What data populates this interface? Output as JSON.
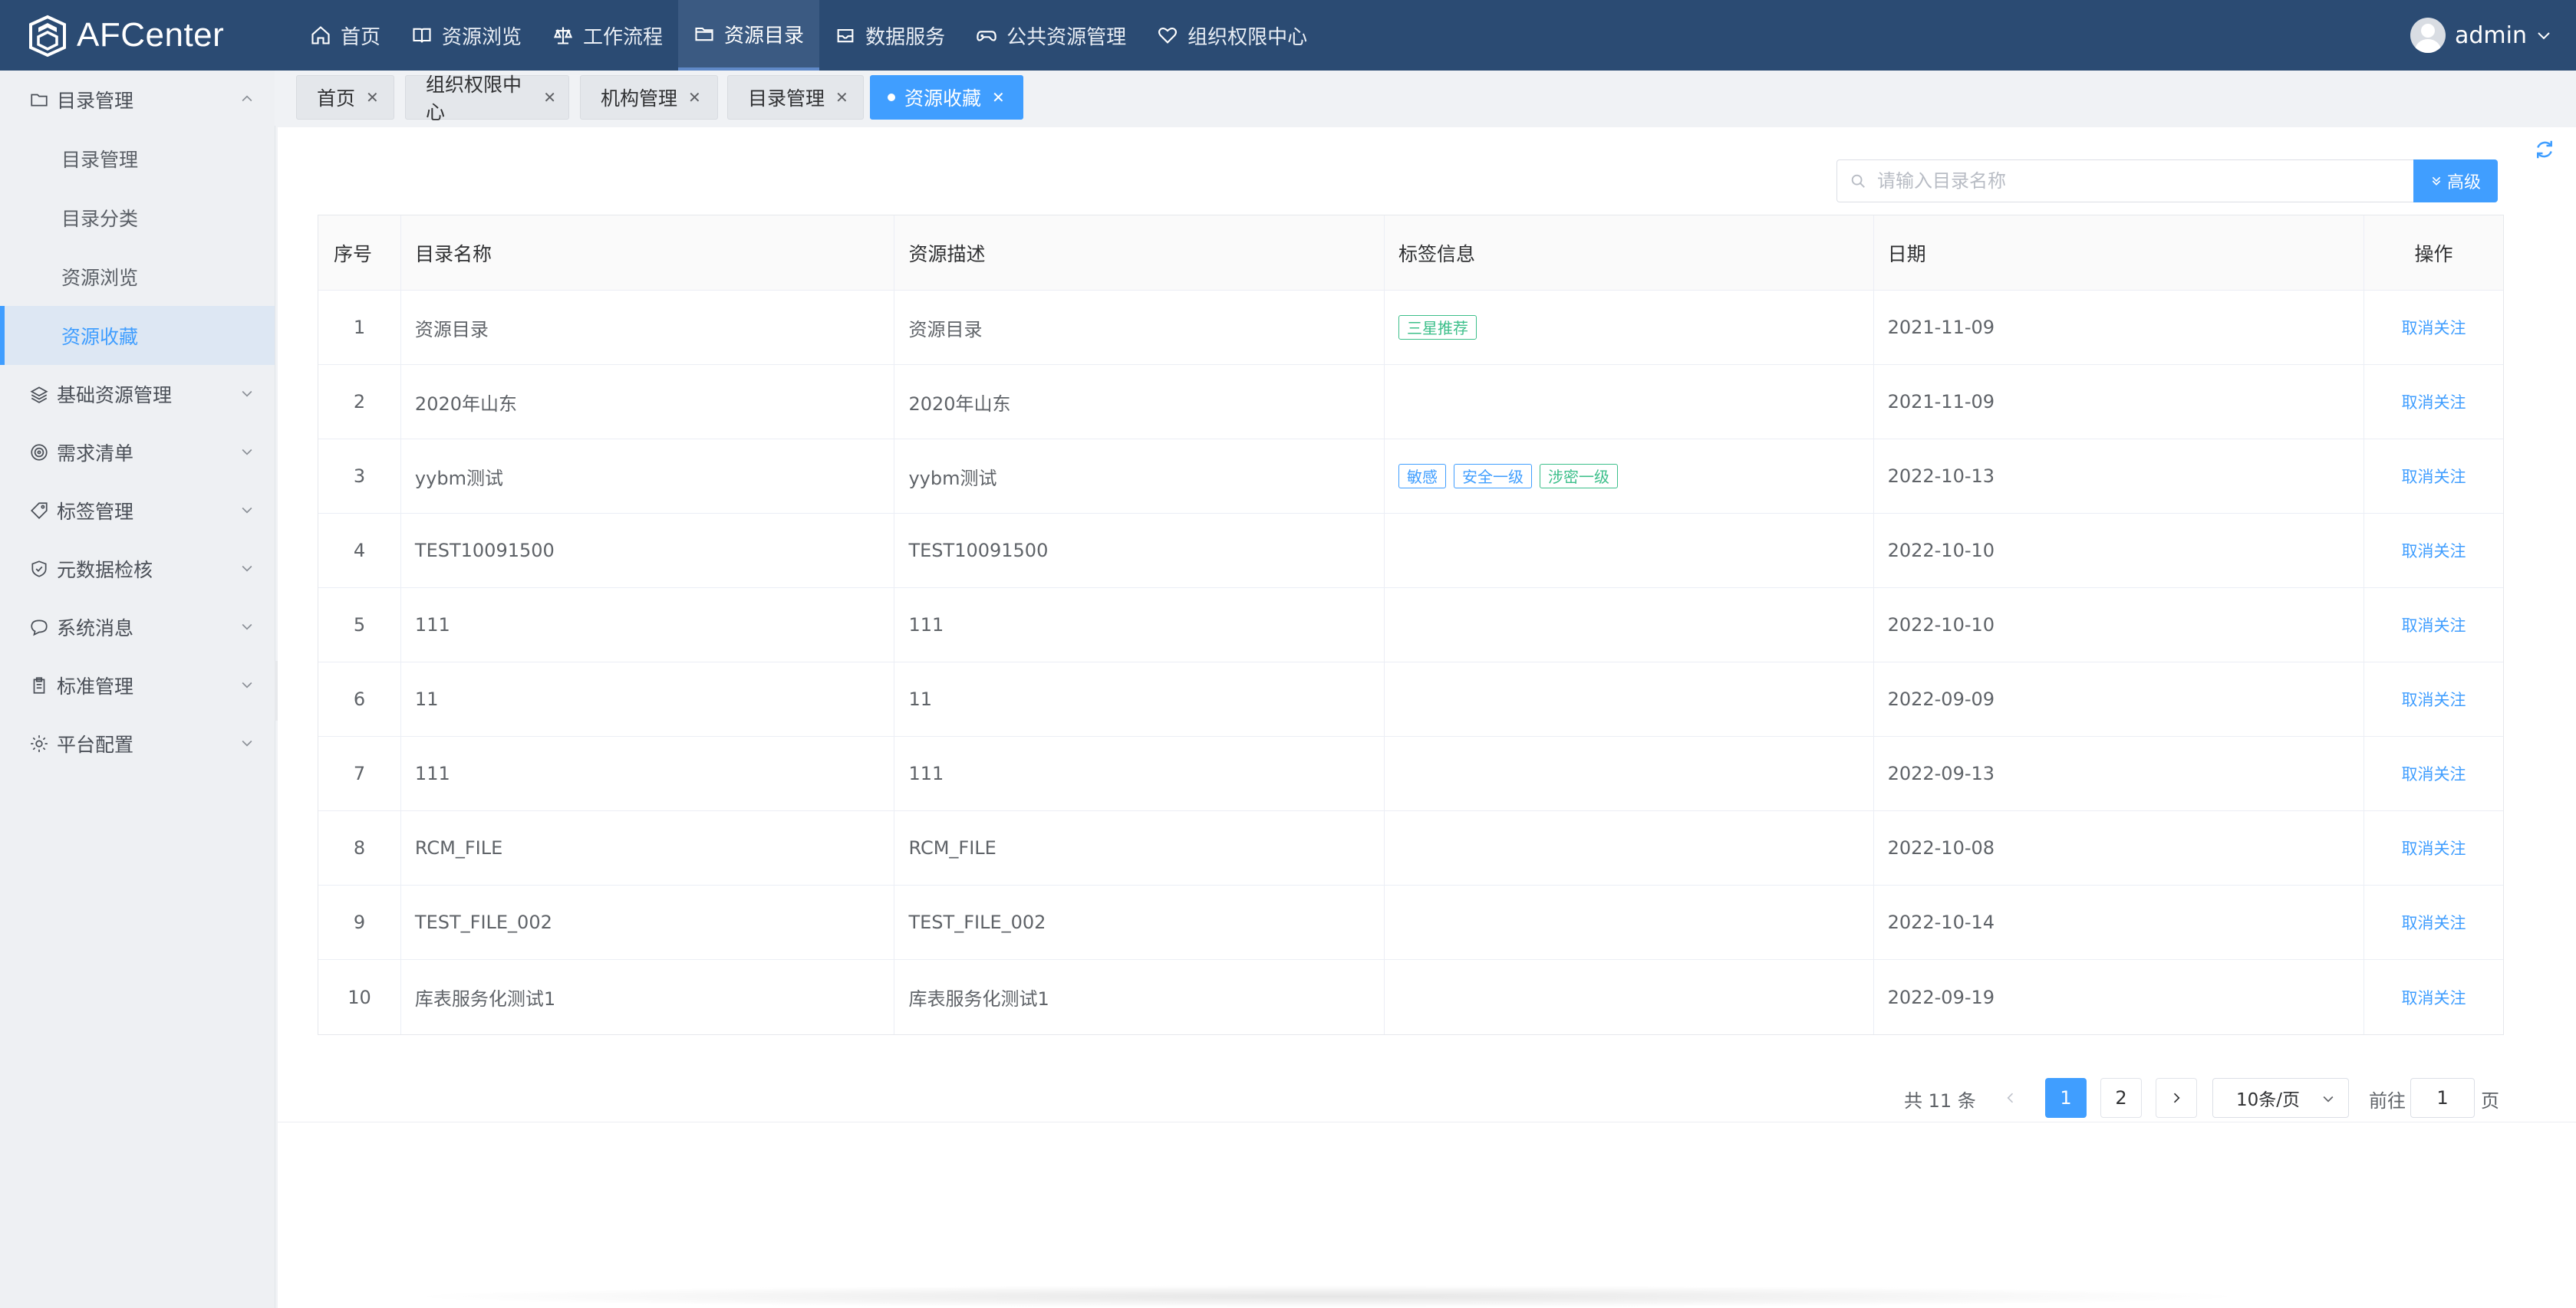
{
  "app": {
    "name": "AFCenter"
  },
  "topnav": [
    {
      "label": "首页",
      "icon": "home-icon"
    },
    {
      "label": "资源浏览",
      "icon": "book-icon"
    },
    {
      "label": "工作流程",
      "icon": "scale-icon"
    },
    {
      "label": "资源目录",
      "icon": "folder-icon",
      "active": true
    },
    {
      "label": "数据服务",
      "icon": "inbox-icon"
    },
    {
      "label": "公共资源管理",
      "icon": "gamepad-icon"
    },
    {
      "label": "组织权限中心",
      "icon": "heart-icon"
    }
  ],
  "user": {
    "name": "admin"
  },
  "sidebar": {
    "groups": [
      {
        "label": "目录管理",
        "icon": "folder-icon",
        "expanded": true,
        "items": [
          {
            "label": "目录管理"
          },
          {
            "label": "目录分类"
          },
          {
            "label": "资源浏览"
          },
          {
            "label": "资源收藏",
            "active": true
          }
        ]
      },
      {
        "label": "基础资源管理",
        "icon": "layers-icon"
      },
      {
        "label": "需求清单",
        "icon": "target-icon"
      },
      {
        "label": "标签管理",
        "icon": "tag-icon"
      },
      {
        "label": "元数据检核",
        "icon": "shield-icon"
      },
      {
        "label": "系统消息",
        "icon": "chat-icon"
      },
      {
        "label": "标准管理",
        "icon": "clipboard-icon"
      },
      {
        "label": "平台配置",
        "icon": "gear-icon"
      }
    ]
  },
  "tabs": [
    {
      "label": "首页"
    },
    {
      "label": "组织权限中心"
    },
    {
      "label": "机构管理"
    },
    {
      "label": "目录管理"
    },
    {
      "label": "资源收藏",
      "active": true
    }
  ],
  "search": {
    "placeholder": "请输入目录名称",
    "value": "",
    "advanced_label": "高级"
  },
  "table": {
    "columns": [
      "序号",
      "目录名称",
      "资源描述",
      "标签信息",
      "日期",
      "操作"
    ],
    "rows": [
      {
        "no": "1",
        "name": "资源目录",
        "desc": "资源目录",
        "tags": [
          {
            "text": "三星推荐",
            "color": "#3cbf8a"
          }
        ],
        "date": "2021-11-09",
        "action": "取消关注"
      },
      {
        "no": "2",
        "name": "2020年山东",
        "desc": "2020年山东",
        "tags": [],
        "date": "2021-11-09",
        "action": "取消关注"
      },
      {
        "no": "3",
        "name": "yybm测试",
        "desc": "yybm测试",
        "tags": [
          {
            "text": "敏感",
            "color": "#409eff"
          },
          {
            "text": "安全一级",
            "color": "#409eff"
          },
          {
            "text": "涉密一级",
            "color": "#3cbf8a"
          }
        ],
        "date": "2022-10-13",
        "action": "取消关注"
      },
      {
        "no": "4",
        "name": "TEST10091500",
        "desc": "TEST10091500",
        "tags": [],
        "date": "2022-10-10",
        "action": "取消关注"
      },
      {
        "no": "5",
        "name": "111",
        "desc": "111",
        "tags": [],
        "date": "2022-10-10",
        "action": "取消关注"
      },
      {
        "no": "6",
        "name": "11",
        "desc": "11",
        "tags": [],
        "date": "2022-09-09",
        "action": "取消关注"
      },
      {
        "no": "7",
        "name": "111",
        "desc": "111",
        "tags": [],
        "date": "2022-09-13",
        "action": "取消关注"
      },
      {
        "no": "8",
        "name": "RCM_FILE",
        "desc": "RCM_FILE",
        "tags": [],
        "date": "2022-10-08",
        "action": "取消关注"
      },
      {
        "no": "9",
        "name": "TEST_FILE_002",
        "desc": "TEST_FILE_002",
        "tags": [],
        "date": "2022-10-14",
        "action": "取消关注"
      },
      {
        "no": "10",
        "name": "库表服务化测试1",
        "desc": "库表服务化测试1",
        "tags": [],
        "date": "2022-09-19",
        "action": "取消关注"
      }
    ]
  },
  "pagination": {
    "total_label": "共 11 条",
    "pages": [
      "1",
      "2"
    ],
    "current": "1",
    "page_size": "10条/页",
    "goto_label": "前往",
    "goto_value": "1",
    "page_suffix": "页"
  },
  "colors": {
    "topbar": "#2b4b73",
    "accent": "#409eff",
    "tag_green": "#3cbf8a"
  }
}
